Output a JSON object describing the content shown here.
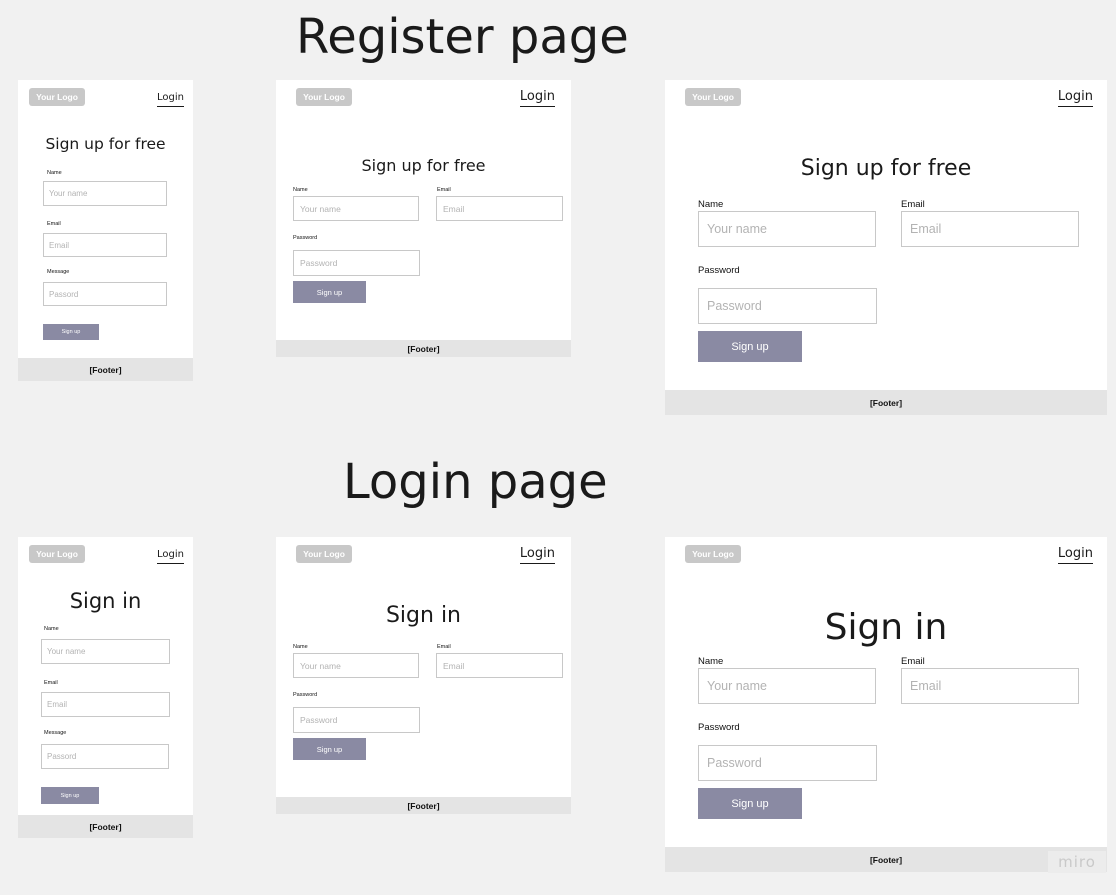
{
  "sections": {
    "register_title": "Register page",
    "login_title": "Login page"
  },
  "common": {
    "logo": "Your Logo",
    "login_link": "Login",
    "footer": "[Footer]"
  },
  "register": {
    "heading": "Sign up for free",
    "small": {
      "name_label": "Name",
      "name_placeholder": "Your name",
      "email_label": "Email",
      "email_placeholder": "Email",
      "message_label": "Message",
      "password_placeholder": "Passord",
      "button": "Sign up"
    },
    "medium": {
      "name_label": "Name",
      "name_placeholder": "Your name",
      "email_label": "Email",
      "email_placeholder": "Email",
      "password_label": "Password",
      "password_placeholder": "Password",
      "button": "Sign up"
    },
    "large": {
      "name_label": "Name",
      "name_placeholder": "Your name",
      "email_label": "Email",
      "email_placeholder": "Email",
      "password_label": "Password",
      "password_placeholder": "Password",
      "button": "Sign up"
    }
  },
  "login": {
    "heading": "Sign in",
    "small": {
      "name_label": "Name",
      "name_placeholder": "Your name",
      "email_label": "Email",
      "email_placeholder": "Email",
      "message_label": "Message",
      "password_placeholder": "Passord",
      "button": "Sign up"
    },
    "medium": {
      "name_label": "Name",
      "name_placeholder": "Your name",
      "email_label": "Email",
      "email_placeholder": "Email",
      "password_label": "Password",
      "password_placeholder": "Password",
      "button": "Sign up"
    },
    "large": {
      "name_label": "Name",
      "name_placeholder": "Your name",
      "email_label": "Email",
      "email_placeholder": "Email",
      "password_label": "Password",
      "password_placeholder": "Password",
      "button": "Sign up"
    }
  },
  "watermark": "miro",
  "colors": {
    "canvas": "#f1f1f1",
    "logo_bg": "#c8c8c8",
    "button": "#8a8aa3",
    "footer_bg": "#e4e4e4",
    "input_border": "#c8c8c8"
  }
}
